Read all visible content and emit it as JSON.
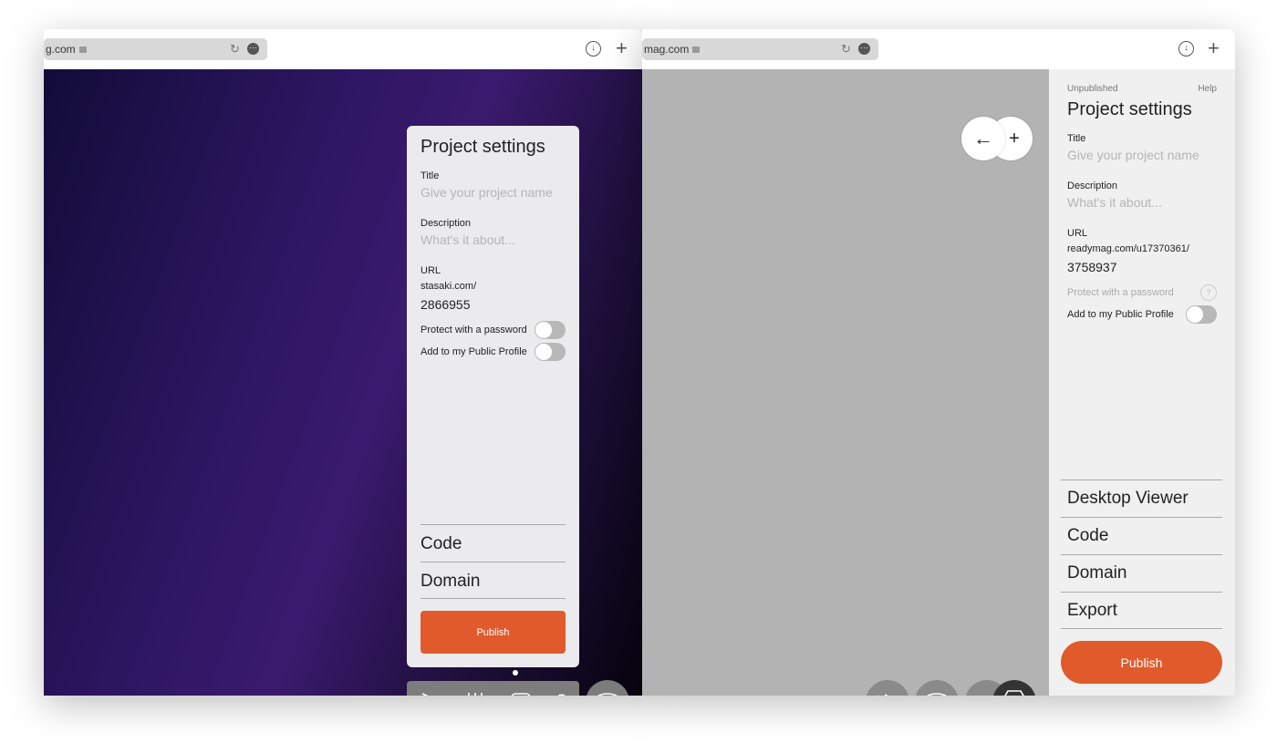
{
  "left_window": {
    "address": "g.com",
    "panel": {
      "title": "Project settings",
      "title_label": "Title",
      "title_placeholder": "Give your project name",
      "description_label": "Description",
      "description_placeholder": "What's it about...",
      "url_label": "URL",
      "url_domain": "stasaki.com/",
      "url_slug": "2866955",
      "password_label": "Protect with a password",
      "password_on": false,
      "profile_label": "Add to my Public Profile",
      "profile_on": false,
      "sections": [
        "Code",
        "Domain"
      ],
      "publish": "Publish"
    },
    "toolbar": {
      "help": "?"
    }
  },
  "right_window": {
    "address": "mag.com",
    "sidebar": {
      "status": "Unpublished",
      "help": "Help",
      "title": "Project settings",
      "title_label": "Title",
      "title_placeholder": "Give your project name",
      "description_label": "Description",
      "description_placeholder": "What's it about...",
      "url_label": "URL",
      "url_domain": "readymag.com/u17370361/",
      "url_slug": "3758937",
      "password_label": "Protect with a password",
      "password_help": "?",
      "profile_label": "Add to my Public Profile",
      "profile_on": false,
      "sections": [
        "Desktop Viewer",
        "Code",
        "Domain",
        "Export"
      ],
      "publish": "Publish"
    }
  },
  "colors": {
    "accent": "#e05a2b"
  }
}
